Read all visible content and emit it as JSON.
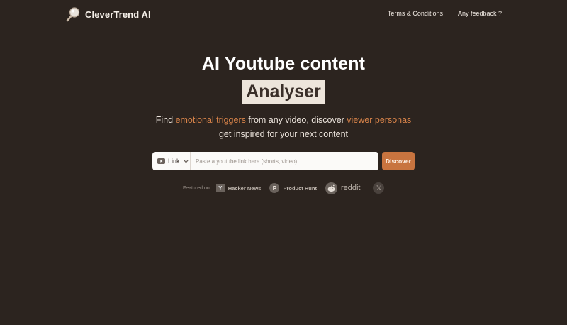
{
  "brand": {
    "name": "CleverTrend AI"
  },
  "nav": {
    "terms": "Terms & Conditions",
    "feedback": "Any feedback ?"
  },
  "hero": {
    "title": "AI Youtube content",
    "highlight": "Analyser",
    "subtitle_pre": "Find ",
    "subtitle_accent1": "emotional triggers",
    "subtitle_mid": " from any video, discover ",
    "subtitle_accent2": "viewer personas",
    "subtitle_line2": "get inspired for your next content"
  },
  "search": {
    "type_label": "Link",
    "placeholder": "Paste a youtube link here (shorts, video)",
    "value": "",
    "button_label": "Discover"
  },
  "featured": {
    "label": "Featured on",
    "items": [
      "Hacker News",
      "Product Hunt",
      "reddit"
    ],
    "hn_letter": "Y",
    "ph_letter": "P",
    "x_letter": "𝕏"
  },
  "colors": {
    "background": "#2c241f",
    "accent": "#d9844a",
    "button": "#c8743f",
    "highlight_bg": "#ede5db"
  }
}
